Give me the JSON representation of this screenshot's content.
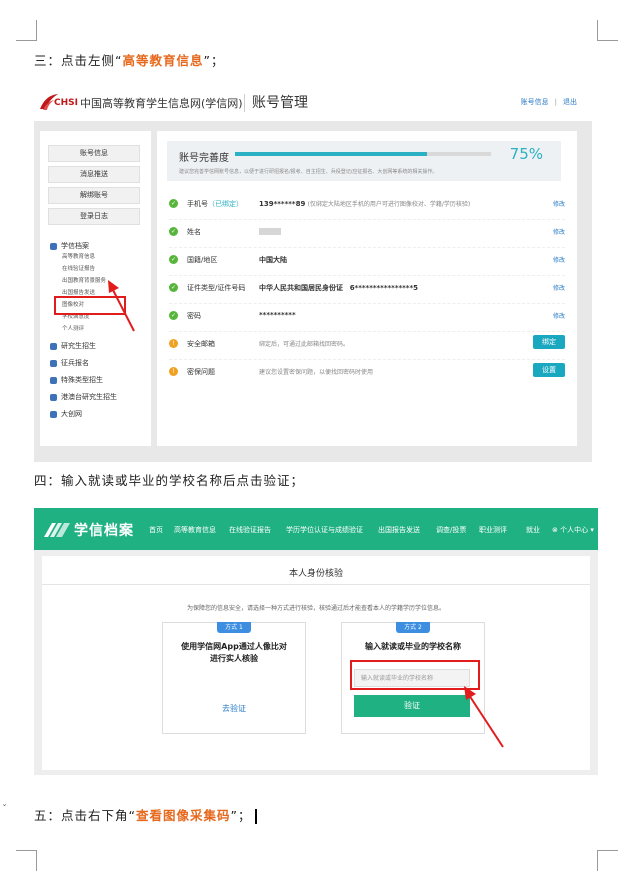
{
  "doc": {
    "step3": {
      "prefix": "三：点击左侧“",
      "highlight": "高等教育信息",
      "suffix": "”；"
    },
    "step4": {
      "text": "四：输入就读或毕业的学校名称后点击验证；"
    },
    "step5": {
      "prefix": "五：点击右下角“",
      "highlight": "查看图像采集码",
      "suffix": "”；"
    },
    "side_mark": "ˇ",
    "highlight_color": "#e6691e"
  },
  "shot1": {
    "header": {
      "logo_text": "CHSI",
      "site_name": "中国高等教育学生信息网(学信网)",
      "page_title": "账号管理",
      "links": [
        "账号信息",
        "|",
        "退出"
      ]
    },
    "left_buttons": [
      "账号信息",
      "消息推送",
      "解绑账号",
      "登录日志"
    ],
    "xuexin_section": {
      "label": "学信档案",
      "items": [
        "高等教育信息",
        "在线验证报告",
        "出国教育背景服务",
        "出国报告发送",
        "图像校对",
        "学校满意度",
        "个人测评"
      ]
    },
    "other_sections": [
      "研究生招生",
      "征兵报名",
      "特殊类型招生",
      "港澳台研究生招生",
      "大创网"
    ],
    "completeness": {
      "label": "账号完善度",
      "value_text": "75%",
      "value": 0.75,
      "tip": "建议您完善学信网账号信息，以便于进行研招报名/报考、自主招生、兵役登记/应征报名、大创网等系统的相关操作。"
    },
    "rows": [
      {
        "status": "ok",
        "label": "手机号",
        "extra": "（已绑定）",
        "value": "139******89",
        "note": "(仅绑定大陆地区手机的用户可进行图像校对、学籍/学历核验)",
        "action": "修改"
      },
      {
        "status": "ok",
        "label": "姓名",
        "value": "",
        "action": "修改"
      },
      {
        "status": "ok",
        "label": "国籍/地区",
        "value": "中国大陆",
        "action": "修改"
      },
      {
        "status": "ok",
        "label": "证件类型/证件号码",
        "value": "中华人民共和国居民身份证",
        "value2": "6****************5",
        "action": "修改"
      },
      {
        "status": "ok",
        "label": "密码",
        "value": "**********",
        "action": "修改"
      },
      {
        "status": "warn",
        "label": "安全邮箱",
        "value": "绑定后，可通过此邮箱找回密码。",
        "button": "绑定"
      },
      {
        "status": "warn",
        "label": "密保问题",
        "value": "建议您设置密保问题，以便找回密码时使用",
        "button": "设置"
      }
    ],
    "colors": {
      "accent": "#2bb0c4",
      "ok": "#56b53a",
      "warn": "#f0a122",
      "button": "#19a8c0",
      "annotation": "#e21c1c"
    }
  },
  "shot2": {
    "nav": {
      "title": "学信档案",
      "items": [
        "首页",
        "高等教育信息",
        "在线验证报告",
        "学历学位认证与成绩验证",
        "出国报告发送",
        "调查/投票",
        "职业测评",
        "就业"
      ],
      "user": "个人中心",
      "color": "#20b183"
    },
    "page_title": "本人身份核验",
    "tip": "为保障您的信息安全，请选择一种方式进行核验，核验通过后才能查看本人的学籍学历学位信息。",
    "method1": {
      "tag": "方式 1",
      "title_line1": "使用学信网App通过人像比对",
      "title_line2": "进行实人核验",
      "link": "去验证"
    },
    "method2": {
      "tag": "方式 2",
      "title": "输入就读或毕业的学校名称",
      "placeholder": "输入就读或毕业的学校名称",
      "button": "验证"
    }
  }
}
